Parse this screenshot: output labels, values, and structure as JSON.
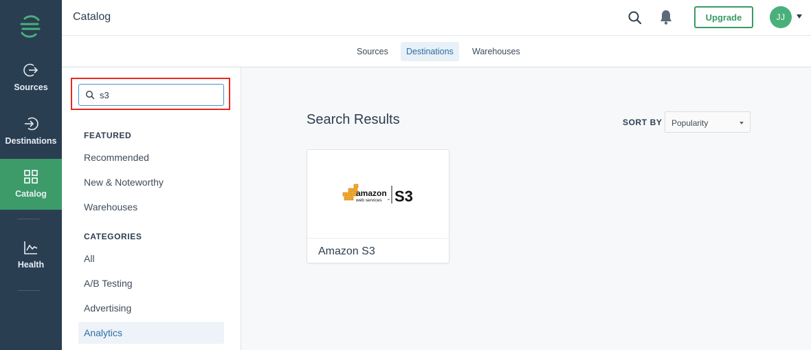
{
  "nav": {
    "items": [
      {
        "label": "Sources",
        "icon": "arrow-out-circle-icon"
      },
      {
        "label": "Destinations",
        "icon": "arrow-in-circle-icon"
      },
      {
        "label": "Catalog",
        "icon": "grid-icon"
      },
      {
        "label": "Health",
        "icon": "chart-line-icon"
      }
    ],
    "active": "Catalog"
  },
  "header": {
    "title": "Catalog",
    "upgrade_label": "Upgrade",
    "avatar_initials": "JJ"
  },
  "subtabs": {
    "items": [
      "Sources",
      "Destinations",
      "Warehouses"
    ],
    "active": "Destinations"
  },
  "sidebar": {
    "search_value": "s3",
    "featured_heading": "FEATURED",
    "featured": [
      "Recommended",
      "New & Noteworthy",
      "Warehouses"
    ],
    "categories_heading": "CATEGORIES",
    "categories": [
      "All",
      "A/B Testing",
      "Advertising",
      "Analytics"
    ],
    "active_category": "Analytics"
  },
  "main": {
    "results_title": "Search Results",
    "sort_label": "SORT BY",
    "sort_value": "Popularity",
    "cards": [
      {
        "name": "Amazon S3",
        "logo_text_brand": "amazon",
        "logo_text_sub": "web services",
        "logo_text_tm": "™",
        "logo_text_product": "S3"
      }
    ]
  },
  "colors": {
    "nav_bg": "#2a3e52",
    "nav_active": "#3d9b6a",
    "accent_green": "#3a9a64",
    "highlight_red": "#e8291c",
    "link_blue": "#2f6da3"
  }
}
